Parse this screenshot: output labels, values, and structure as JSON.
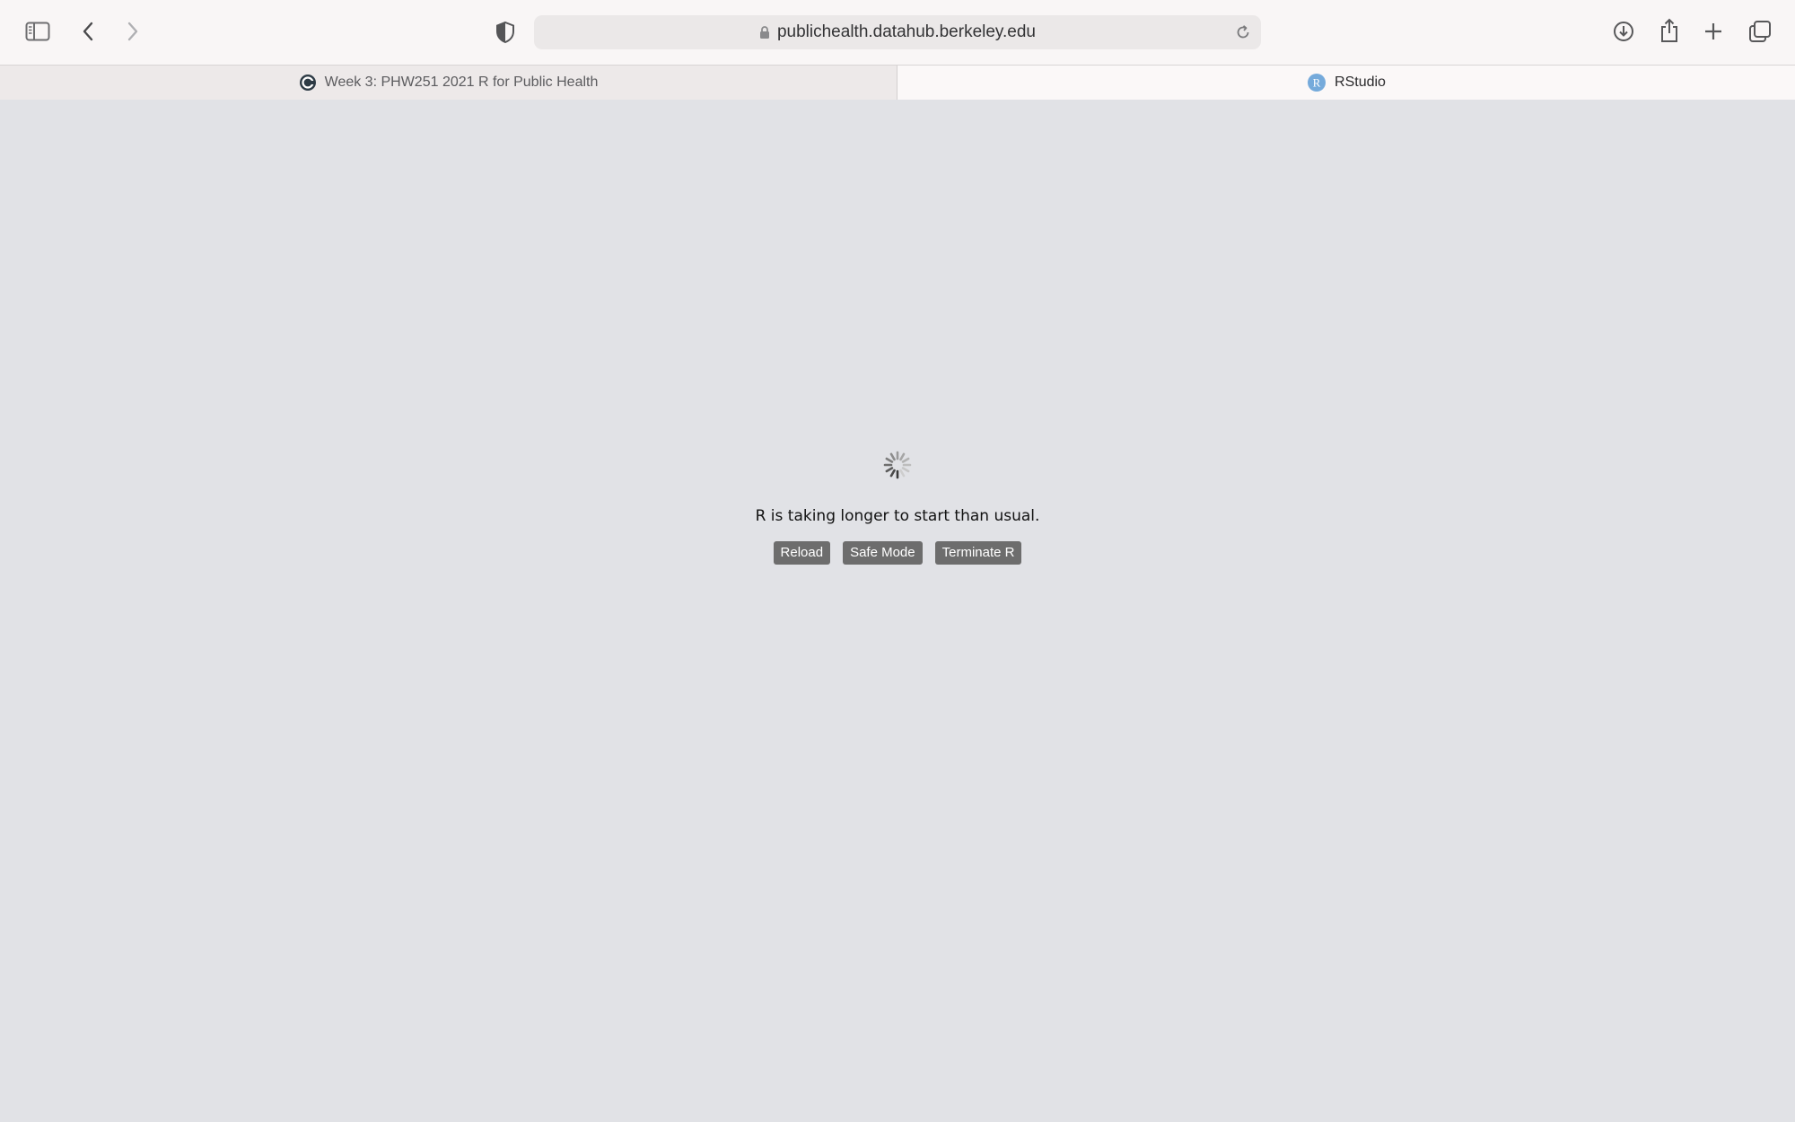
{
  "browser": {
    "address_bar": {
      "url": "publichealth.datahub.berkeley.edu"
    },
    "toolbar_icons": [
      "sidebar-icon",
      "back-icon",
      "forward-icon",
      "privacy-shield-icon",
      "download-icon",
      "share-icon",
      "new-tab-icon",
      "tab-overview-icon"
    ],
    "tabs": [
      {
        "label": "Week 3: PHW251 2021 R for Public Health",
        "active": false,
        "favicon": "canvas-icon"
      },
      {
        "label": "RStudio",
        "active": true,
        "favicon": "rstudio-icon"
      }
    ]
  },
  "page": {
    "status_message": "R is taking longer to start than usual.",
    "buttons": {
      "reload": "Reload",
      "safe_mode": "Safe Mode",
      "terminate": "Terminate R"
    }
  },
  "colors": {
    "background": "#e1e2e6",
    "button_bg": "#6d6d6d",
    "button_text": "#ffffff",
    "rstudio_favicon": "#75aadb"
  }
}
